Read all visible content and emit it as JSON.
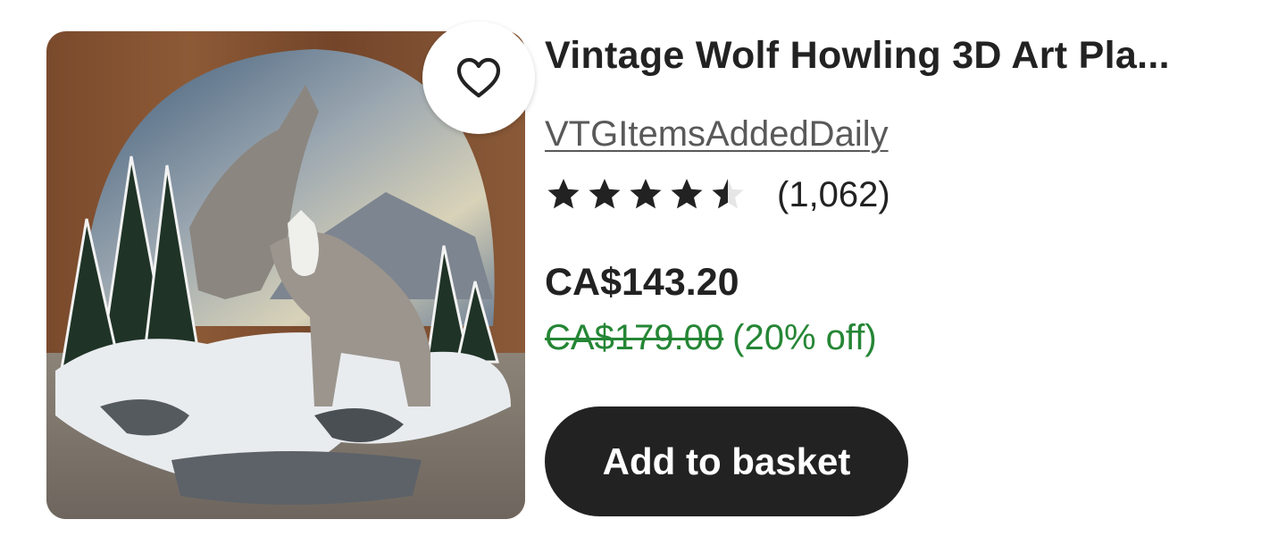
{
  "listing": {
    "image_alt": "Wolf figurine plate",
    "title": "Vintage Wolf Howling 3D Art Pla...",
    "shop_name": "VTGItemsAddedDaily",
    "rating": 4.5,
    "review_count": "(1,062)",
    "price": "CA$143.20",
    "original_price": "CA$179.00",
    "discount": "(20% off)",
    "add_to_basket_label": "Add to basket",
    "favorite_icon": "heart-outline-icon"
  },
  "colors": {
    "text": "#222222",
    "muted": "#595959",
    "sale_green": "#258635",
    "button_bg": "#222222",
    "button_text": "#ffffff"
  }
}
